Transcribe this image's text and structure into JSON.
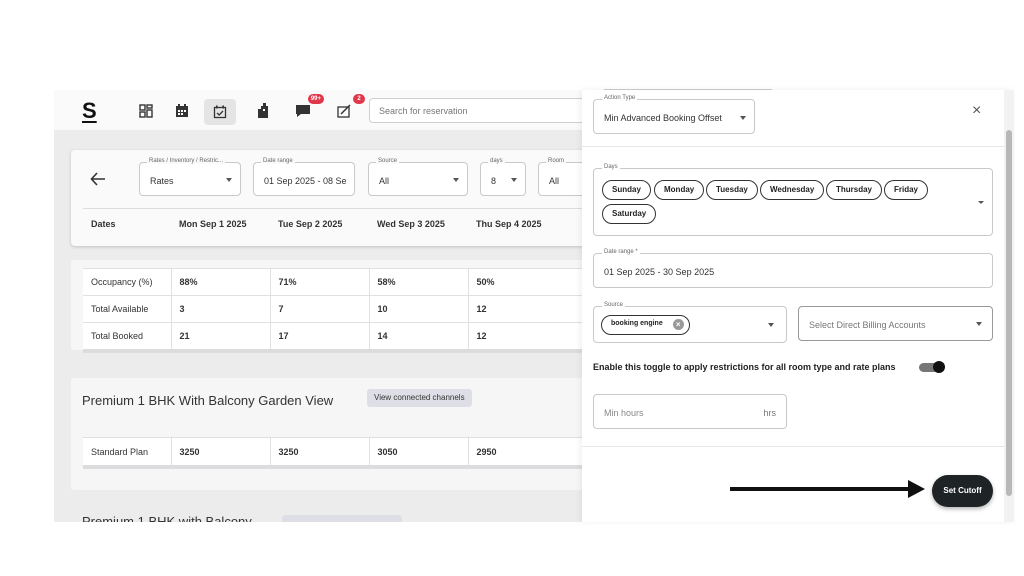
{
  "topbar": {
    "logo": "S",
    "search_placeholder": "Search for reservation",
    "badges": {
      "messages": "99+",
      "tasks": "2"
    }
  },
  "filters": {
    "rates_inventory": {
      "label": "Rates / Inventory / Restric...",
      "value": "Rates"
    },
    "date_range": {
      "label": "Date range",
      "value": "01 Sep 2025 - 08 Se"
    },
    "source": {
      "label": "Source",
      "value": "All"
    },
    "days": {
      "label": "days",
      "value": "8"
    },
    "room": {
      "label": "Room",
      "value": "All"
    }
  },
  "date_header": [
    "Dates",
    "Mon Sep 1 2025",
    "Tue Sep 2 2025",
    "Wed Sep 3 2025",
    "Thu Sep 4 2025"
  ],
  "occupancy_rows": [
    {
      "label": "Occupancy (%)",
      "values": [
        "88%",
        "71%",
        "58%",
        "50%"
      ]
    },
    {
      "label": "Total Available",
      "values": [
        "3",
        "7",
        "10",
        "12"
      ]
    },
    {
      "label": "Total Booked",
      "values": [
        "21",
        "17",
        "14",
        "12"
      ]
    }
  ],
  "room": {
    "title": "Premium 1 BHK With Balcony Garden View",
    "view_channels": "View connected channels",
    "rate_plan": {
      "label": "Standard Plan",
      "values": [
        "3250",
        "3250",
        "3050",
        "2950"
      ]
    },
    "next_title": "Premium 1 BHK with Balcony"
  },
  "panel": {
    "action_type": {
      "label": "Action Type",
      "value": "Min Advanced Booking Offset"
    },
    "days": {
      "label": "Days",
      "chips": [
        "Sunday",
        "Monday",
        "Tuesday",
        "Wednesday",
        "Thursday",
        "Friday",
        "Saturday"
      ]
    },
    "date_range": {
      "label": "Date range *",
      "value": "01 Sep 2025 - 30 Sep 2025"
    },
    "source": {
      "label": "Source",
      "chip": "booking engine"
    },
    "billing_placeholder": "Select Direct Billing Accounts",
    "toggle_text": "Enable this toggle to apply restrictions for all room type and rate plans",
    "toggle_on": true,
    "min_hours_placeholder": "Min hours",
    "min_hours_unit": "hrs",
    "set_cutoff": "Set Cutoff",
    "close": "×"
  }
}
